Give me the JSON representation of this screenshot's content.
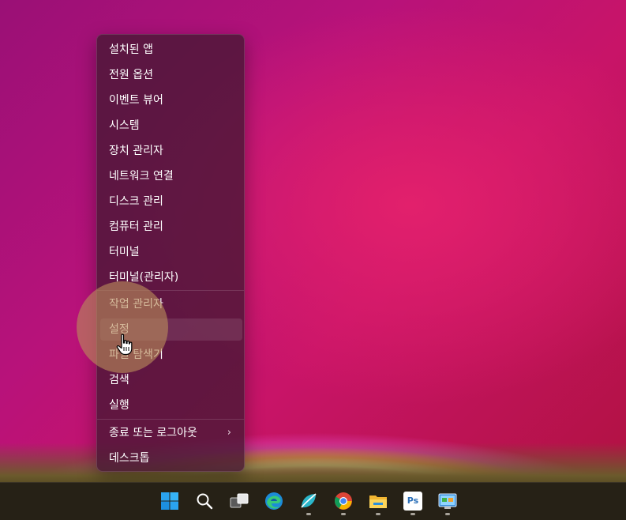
{
  "context_menu": {
    "items": [
      {
        "label": "설치된 앱"
      },
      {
        "label": "전원 옵션"
      },
      {
        "label": "이벤트 뷰어"
      },
      {
        "label": "시스템"
      },
      {
        "label": "장치 관리자"
      },
      {
        "label": "네트워크 연결"
      },
      {
        "label": "디스크 관리"
      },
      {
        "label": "컴퓨터 관리"
      },
      {
        "label": "터미널"
      },
      {
        "label": "터미널(관리자)"
      },
      {
        "label": "작업 관리자"
      },
      {
        "label": "설정"
      },
      {
        "label": "파일 탐색기"
      },
      {
        "label": "검색"
      },
      {
        "label": "실행"
      },
      {
        "label": "종료 또는 로그아웃",
        "submenu_arrow": "›"
      },
      {
        "label": "데스크톱"
      }
    ],
    "hovered_item": "설정"
  },
  "taskbar": {
    "icons": [
      "start-icon",
      "search-icon",
      "task-view-icon",
      "edge-icon",
      "app-icon",
      "chrome-icon",
      "file-explorer-icon",
      "photoshop-icon",
      "control-panel-icon"
    ],
    "photoshop_label": "Ps"
  },
  "colors": {
    "menu_background": "#481834",
    "taskbar_background": "#262116",
    "highlight": "#b98c5a"
  }
}
